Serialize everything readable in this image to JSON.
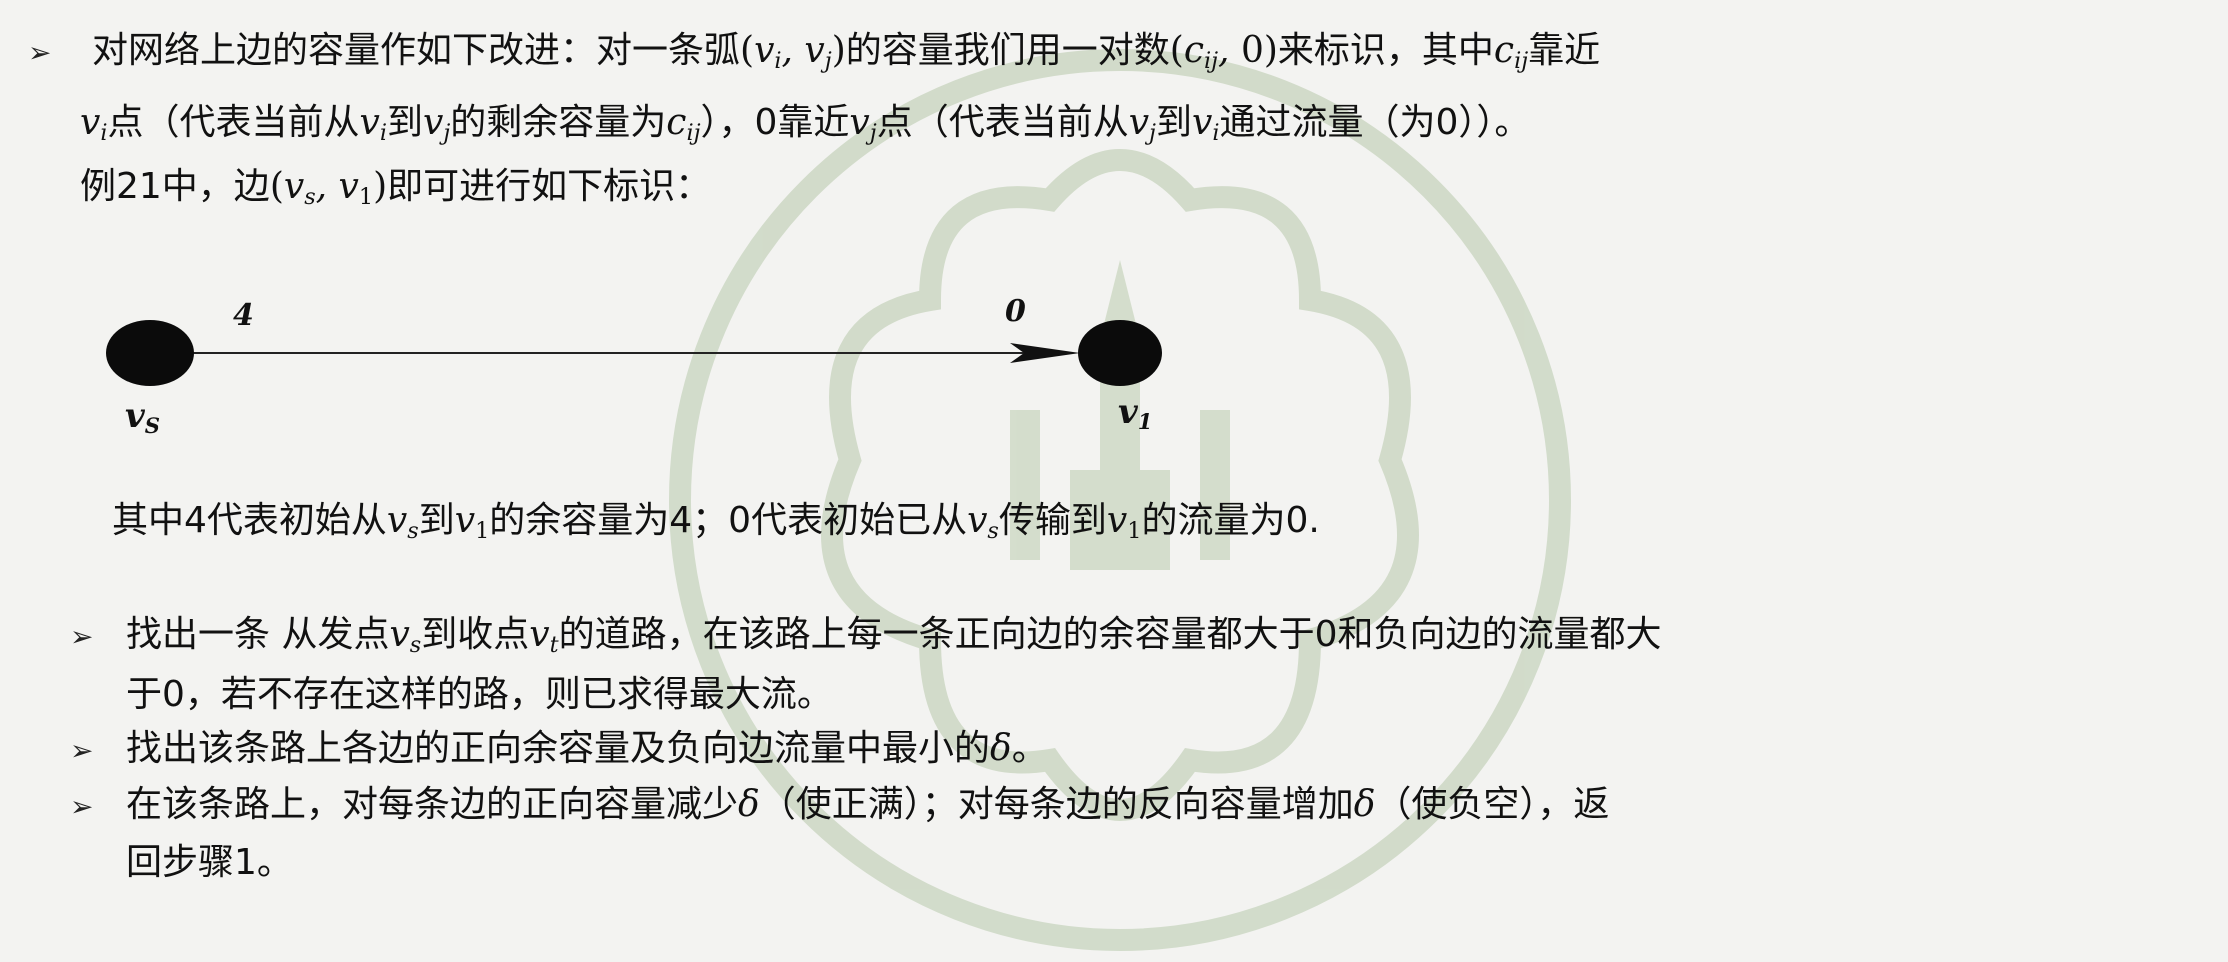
{
  "intro": {
    "line1_a": "对网络上边的容量作如下改进：对一条弧",
    "line1_b": "的容量我们用一对数",
    "line1_c": "来标识，其中",
    "line1_d": "靠近",
    "line2_a": "点（代表当前从",
    "line2_b": "到",
    "line2_c": "的剩余容量为",
    "line2_d": "），0靠近",
    "line2_e": "点（代表当前从",
    "line2_f": "到",
    "line2_g": "通过流量（为0））。",
    "line3_a": "例21中，边",
    "line3_b": "即可进行如下标识："
  },
  "diagram": {
    "capacity_label": "4",
    "flow_label": "0",
    "source_node": "v",
    "source_sub": "S",
    "target_node": "v",
    "target_sub": "1"
  },
  "explanation": {
    "a": "其中4代表初始从",
    "b": "到",
    "c": "的余容量为4；0代表初始已从",
    "d": "传输到",
    "e": "的流量为0."
  },
  "steps": [
    {
      "a": "找出一条 从发点",
      "b": "到收点",
      "c": "的道路，在该路上每一条正向边的余容量都大于0和负向边的流量都大",
      "d": "于0，若不存在这样的路，则已求得最大流。"
    },
    {
      "a": "找出该条路上各边的正向余容量及负向边流量中最小的",
      "b": "。"
    },
    {
      "a": "在该条路上，对每条边的正向容量减少",
      "b": "（使正满）；对每条边的反向容量增加",
      "c": "（使负空），返",
      "d": "回步骤1。"
    }
  ],
  "colors": {
    "background": "#f3f3f1",
    "watermark": "#c7d4bd",
    "node": "#0b0b0b"
  }
}
